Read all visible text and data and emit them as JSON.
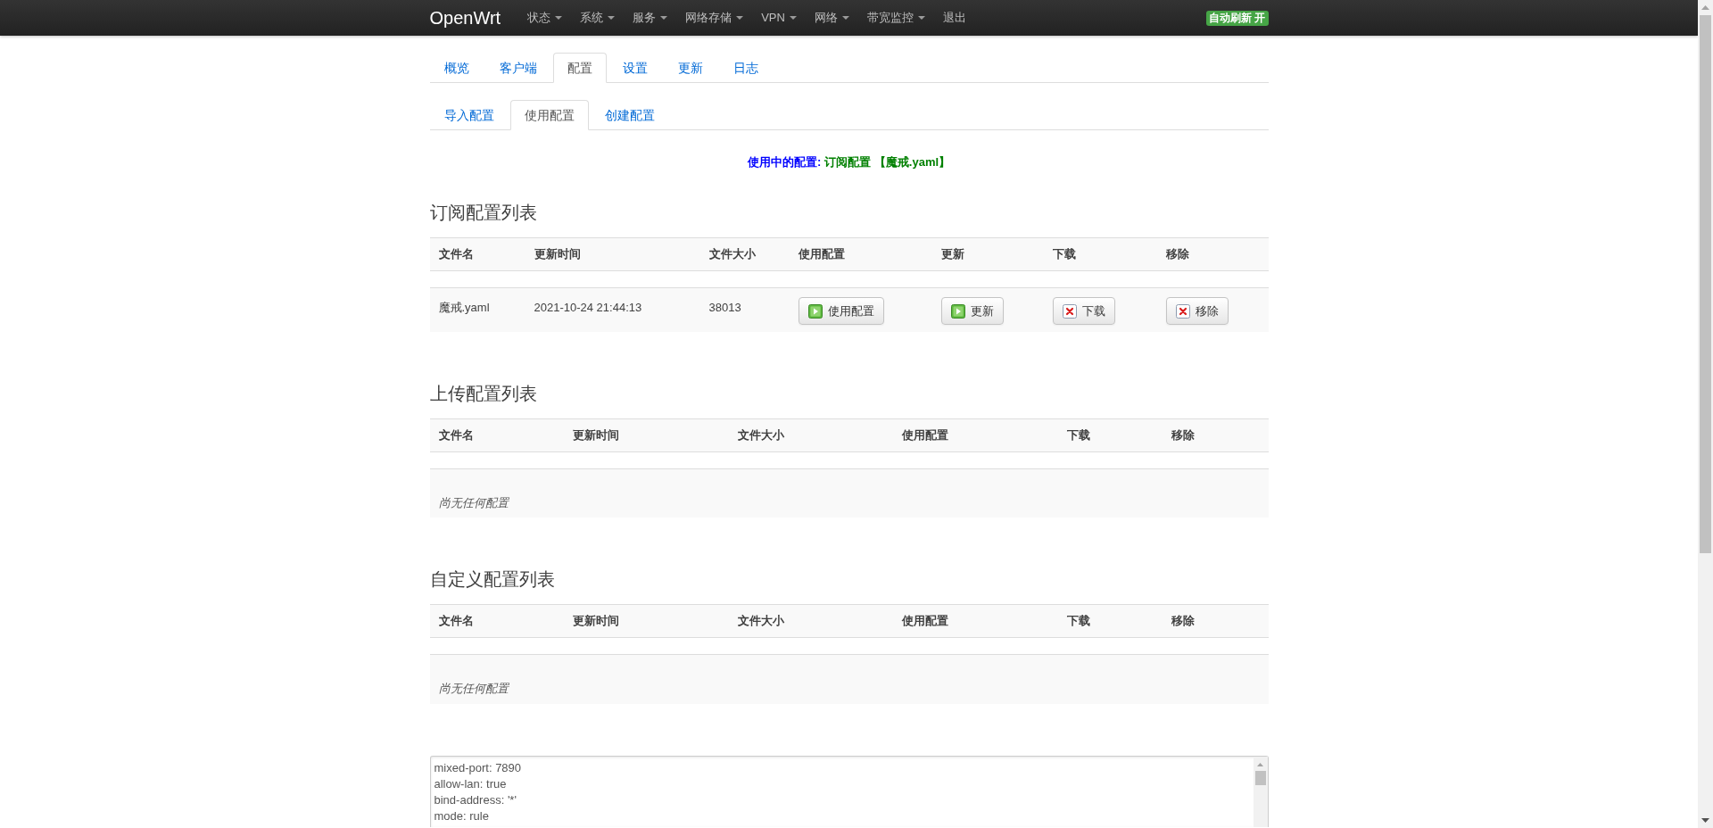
{
  "navbar": {
    "brand": "OpenWrt",
    "menu": [
      {
        "label": "状态",
        "dropdown": true
      },
      {
        "label": "系统",
        "dropdown": true
      },
      {
        "label": "服务",
        "dropdown": true
      },
      {
        "label": "网络存储",
        "dropdown": true
      },
      {
        "label": "VPN",
        "dropdown": true
      },
      {
        "label": "网络",
        "dropdown": true
      },
      {
        "label": "带宽监控",
        "dropdown": true
      },
      {
        "label": "退出",
        "dropdown": false
      }
    ],
    "badge": "自动刷新 开"
  },
  "tabs": [
    {
      "label": "概览",
      "selected": false
    },
    {
      "label": "客户端",
      "selected": false
    },
    {
      "label": "配置",
      "selected": true
    },
    {
      "label": "设置",
      "selected": false
    },
    {
      "label": "更新",
      "selected": false
    },
    {
      "label": "日志",
      "selected": false
    }
  ],
  "subtabs": [
    {
      "label": "导入配置",
      "selected": false
    },
    {
      "label": "使用配置",
      "selected": true
    },
    {
      "label": "创建配置",
      "selected": false
    }
  ],
  "active_config": {
    "label": "使用中的配置:",
    "value": "订阅配置 【魔戒.yaml】"
  },
  "sections": [
    {
      "title": "订阅配置列表",
      "columns": [
        "文件名",
        "更新时间",
        "文件大小",
        "使用配置",
        "更新",
        "下载",
        "移除"
      ],
      "rows": [
        {
          "cells": [
            "魔戒.yaml",
            "2021-10-24 21:44:13",
            "38013"
          ],
          "buttons": [
            {
              "label": "使用配置",
              "kind": "apply"
            },
            {
              "label": "更新",
              "kind": "apply"
            },
            {
              "label": "下载",
              "kind": "remove"
            },
            {
              "label": "移除",
              "kind": "remove"
            }
          ]
        }
      ]
    },
    {
      "title": "上传配置列表",
      "columns": [
        "文件名",
        "更新时间",
        "文件大小",
        "使用配置",
        "下载",
        "移除"
      ],
      "empty_text": "尚无任何配置"
    },
    {
      "title": "自定义配置列表",
      "columns": [
        "文件名",
        "更新时间",
        "文件大小",
        "使用配置",
        "下载",
        "移除"
      ],
      "empty_text": "尚无任何配置"
    }
  ],
  "editor": {
    "lines": [
      "mixed-port: 7890",
      "allow-lan: true",
      "bind-address: '*'",
      "mode: rule"
    ]
  }
}
